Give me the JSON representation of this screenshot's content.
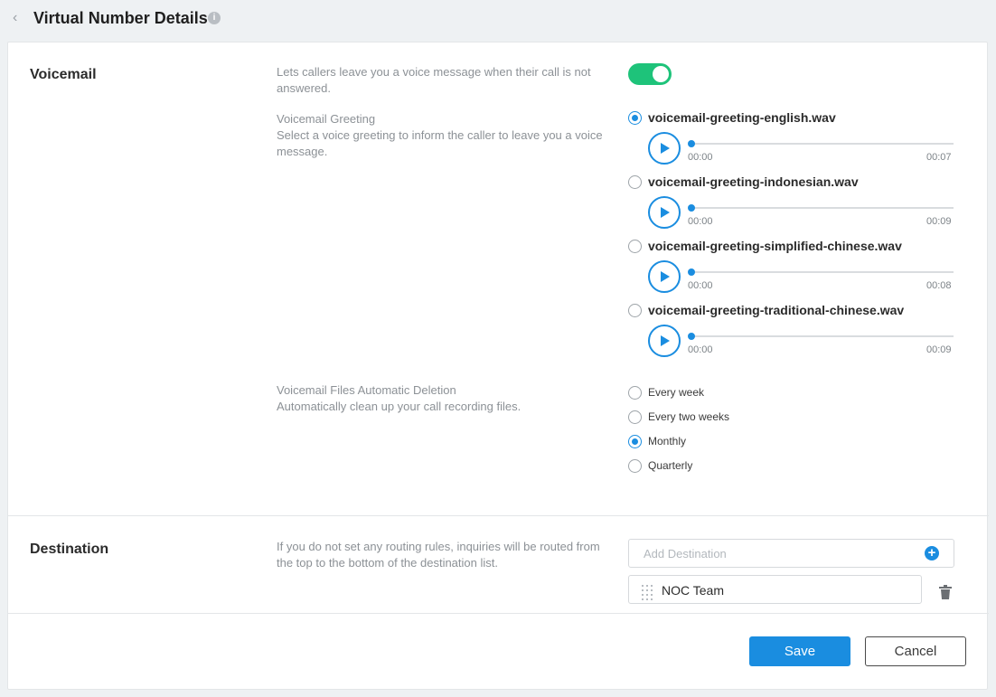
{
  "header": {
    "back_icon": "chevron-left-icon",
    "title": "Virtual Number Details",
    "info_icon": "info-icon"
  },
  "voicemail": {
    "title": "Voicemail",
    "description": "Lets callers leave you a voice message when their call is not answered.",
    "enabled": true,
    "greeting": {
      "label": "Voicemail Greeting",
      "description": "Select a voice greeting to inform the caller to leave you a voice message.",
      "files": [
        {
          "name": "voicemail-greeting-english.wav",
          "current": "00:00",
          "duration": "00:07",
          "selected": true
        },
        {
          "name": "voicemail-greeting-indonesian.wav",
          "current": "00:00",
          "duration": "00:09",
          "selected": false
        },
        {
          "name": "voicemail-greeting-simplified-chinese.wav",
          "current": "00:00",
          "duration": "00:08",
          "selected": false
        },
        {
          "name": "voicemail-greeting-traditional-chinese.wav",
          "current": "00:00",
          "duration": "00:09",
          "selected": false
        }
      ]
    },
    "deletion": {
      "label": "Voicemail Files Automatic Deletion",
      "description": "Automatically clean up your call recording files.",
      "options": [
        {
          "label": "Every week",
          "selected": false
        },
        {
          "label": "Every two weeks",
          "selected": false
        },
        {
          "label": "Monthly",
          "selected": true
        },
        {
          "label": "Quarterly",
          "selected": false
        }
      ]
    }
  },
  "destination": {
    "title": "Destination",
    "description": "If you do not set any routing rules, inquiries will be routed from the top to the bottom of the destination list.",
    "add_placeholder": "Add Destination",
    "items": [
      {
        "name": "NOC Team"
      }
    ]
  },
  "footer": {
    "save_label": "Save",
    "cancel_label": "Cancel"
  },
  "colors": {
    "accent": "#1a8de0",
    "toggle_on": "#1ec37a"
  }
}
